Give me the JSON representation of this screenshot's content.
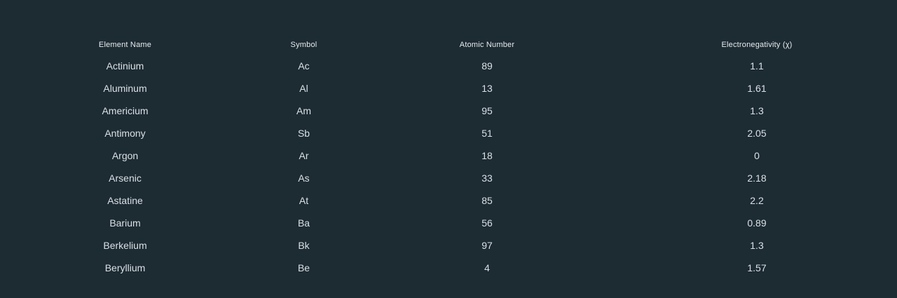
{
  "table": {
    "columns": [
      "Element Name",
      "Symbol",
      "Atomic Number",
      "Electronegativity (χ)"
    ],
    "rows": [
      [
        "Actinium",
        "Ac",
        "89",
        "1.1"
      ],
      [
        "Aluminum",
        "Al",
        "13",
        "1.61"
      ],
      [
        "Americium",
        "Am",
        "95",
        "1.3"
      ],
      [
        "Antimony",
        "Sb",
        "51",
        "2.05"
      ],
      [
        "Argon",
        "Ar",
        "18",
        "0"
      ],
      [
        "Arsenic",
        "As",
        "33",
        "2.18"
      ],
      [
        "Astatine",
        "At",
        "85",
        "2.2"
      ],
      [
        "Barium",
        "Ba",
        "56",
        "0.89"
      ],
      [
        "Berkelium",
        "Bk",
        "97",
        "1.3"
      ],
      [
        "Beryllium",
        "Be",
        "4",
        "1.57"
      ]
    ]
  }
}
